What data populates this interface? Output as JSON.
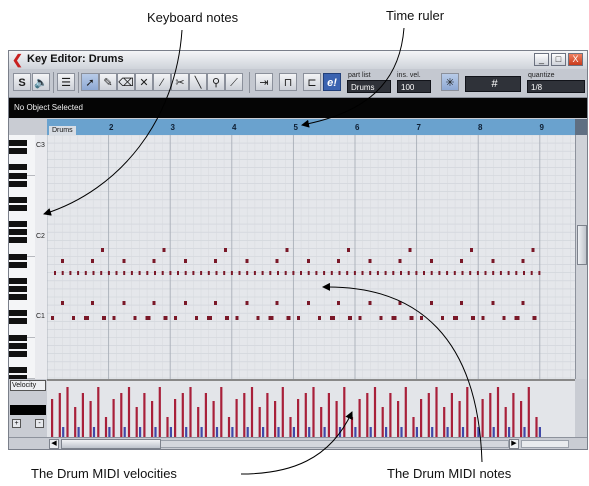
{
  "callouts": {
    "keyboard_notes": "Keyboard notes",
    "time_ruler": "Time ruler",
    "drum_velocities": "The Drum MIDI velocities",
    "drum_notes": "The Drum MIDI notes"
  },
  "window": {
    "title": "Key Editor: Drums",
    "minimize": "_",
    "maximize": "□",
    "close": "X"
  },
  "toolbar": {
    "solo_label": "S",
    "part_list_label": "part list",
    "part_list_value": "Drums",
    "ins_vel_label": "ins. vel.",
    "ins_vel_value": "100",
    "grid_symbol": "#",
    "quantize_label": "quantize",
    "quantize_value": "1/8",
    "edit_inplace": "e!"
  },
  "status": {
    "text": "No Object Selected"
  },
  "ruler": {
    "part_name": "Drums",
    "bars": [
      "2",
      "3",
      "4",
      "5",
      "6",
      "7",
      "8",
      "9"
    ]
  },
  "keyboard": {
    "labels": [
      "C3",
      "C2",
      "C1"
    ]
  },
  "velocity": {
    "selector_label": "Velocity",
    "plus": "+",
    "minus": "-"
  },
  "colors": {
    "note_fill": "#7a1828",
    "velocity_high": "#a8203a",
    "velocity_low": "#4048a8",
    "ruler": "#6aa2ce"
  }
}
